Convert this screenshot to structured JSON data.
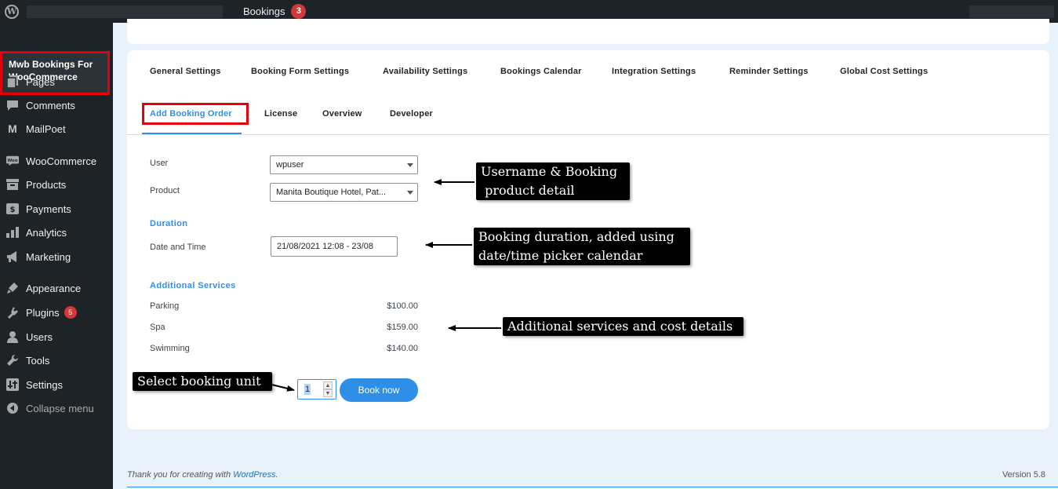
{
  "admin_bar": {
    "bookings_label": "Bookings",
    "bookings_count": "3"
  },
  "sidebar": {
    "current_plugin": "Mwb Bookings For WooCommerce",
    "items": [
      {
        "label": "Pages",
        "icon": "pages-icon"
      },
      {
        "label": "Comments",
        "icon": "comments-icon"
      },
      {
        "label": "MailPoet",
        "icon": "mailpoet-icon"
      },
      {
        "label": "WooCommerce",
        "icon": "woocommerce-icon"
      },
      {
        "label": "Products",
        "icon": "products-icon"
      },
      {
        "label": "Payments",
        "icon": "payments-icon"
      },
      {
        "label": "Analytics",
        "icon": "analytics-icon"
      },
      {
        "label": "Marketing",
        "icon": "marketing-icon"
      },
      {
        "label": "Appearance",
        "icon": "appearance-icon"
      },
      {
        "label": "Plugins",
        "icon": "plugins-icon",
        "badge": "5"
      },
      {
        "label": "Users",
        "icon": "users-icon"
      },
      {
        "label": "Tools",
        "icon": "tools-icon"
      },
      {
        "label": "Settings",
        "icon": "settings-icon"
      },
      {
        "label": "Collapse menu",
        "icon": "collapse-icon"
      }
    ]
  },
  "tabs": {
    "row1": [
      "General Settings",
      "Booking Form Settings",
      "Availability Settings",
      "Bookings Calendar",
      "Integration Settings",
      "Reminder Settings",
      "Global Cost Settings"
    ],
    "row2": [
      "Add Booking Order",
      "License",
      "Overview",
      "Developer"
    ],
    "active": "Add Booking Order"
  },
  "form": {
    "user_label": "User",
    "user_value": "wpuser",
    "product_label": "Product",
    "product_value": "Manita Boutique Hotel, Pat...",
    "duration_title": "Duration",
    "datetime_label": "Date and Time",
    "datetime_value": "21/08/2021 12:08 - 23/08",
    "additional_title": "Additional Services",
    "services": [
      {
        "name": "Parking",
        "price": "$100.00"
      },
      {
        "name": "Spa",
        "price": "$159.00"
      },
      {
        "name": "Swimming",
        "price": "$140.00"
      }
    ],
    "quantity": "1",
    "book_now": "Book now"
  },
  "annotations": {
    "username": [
      "Username & Booking",
      " product detail"
    ],
    "duration": [
      "Booking duration, added using",
      "date/time picker calendar"
    ],
    "services": "Additional services and cost details",
    "unit": "Select booking unit"
  },
  "footer": {
    "thanks_prefix": "Thank you for creating with ",
    "thanks_link": "WordPress",
    "thanks_suffix": ".",
    "version": "Version 5.8"
  },
  "colors": {
    "accent": "#2e8ee8",
    "highlight": "#e6000b",
    "sidebar_bg": "#1d2327"
  }
}
